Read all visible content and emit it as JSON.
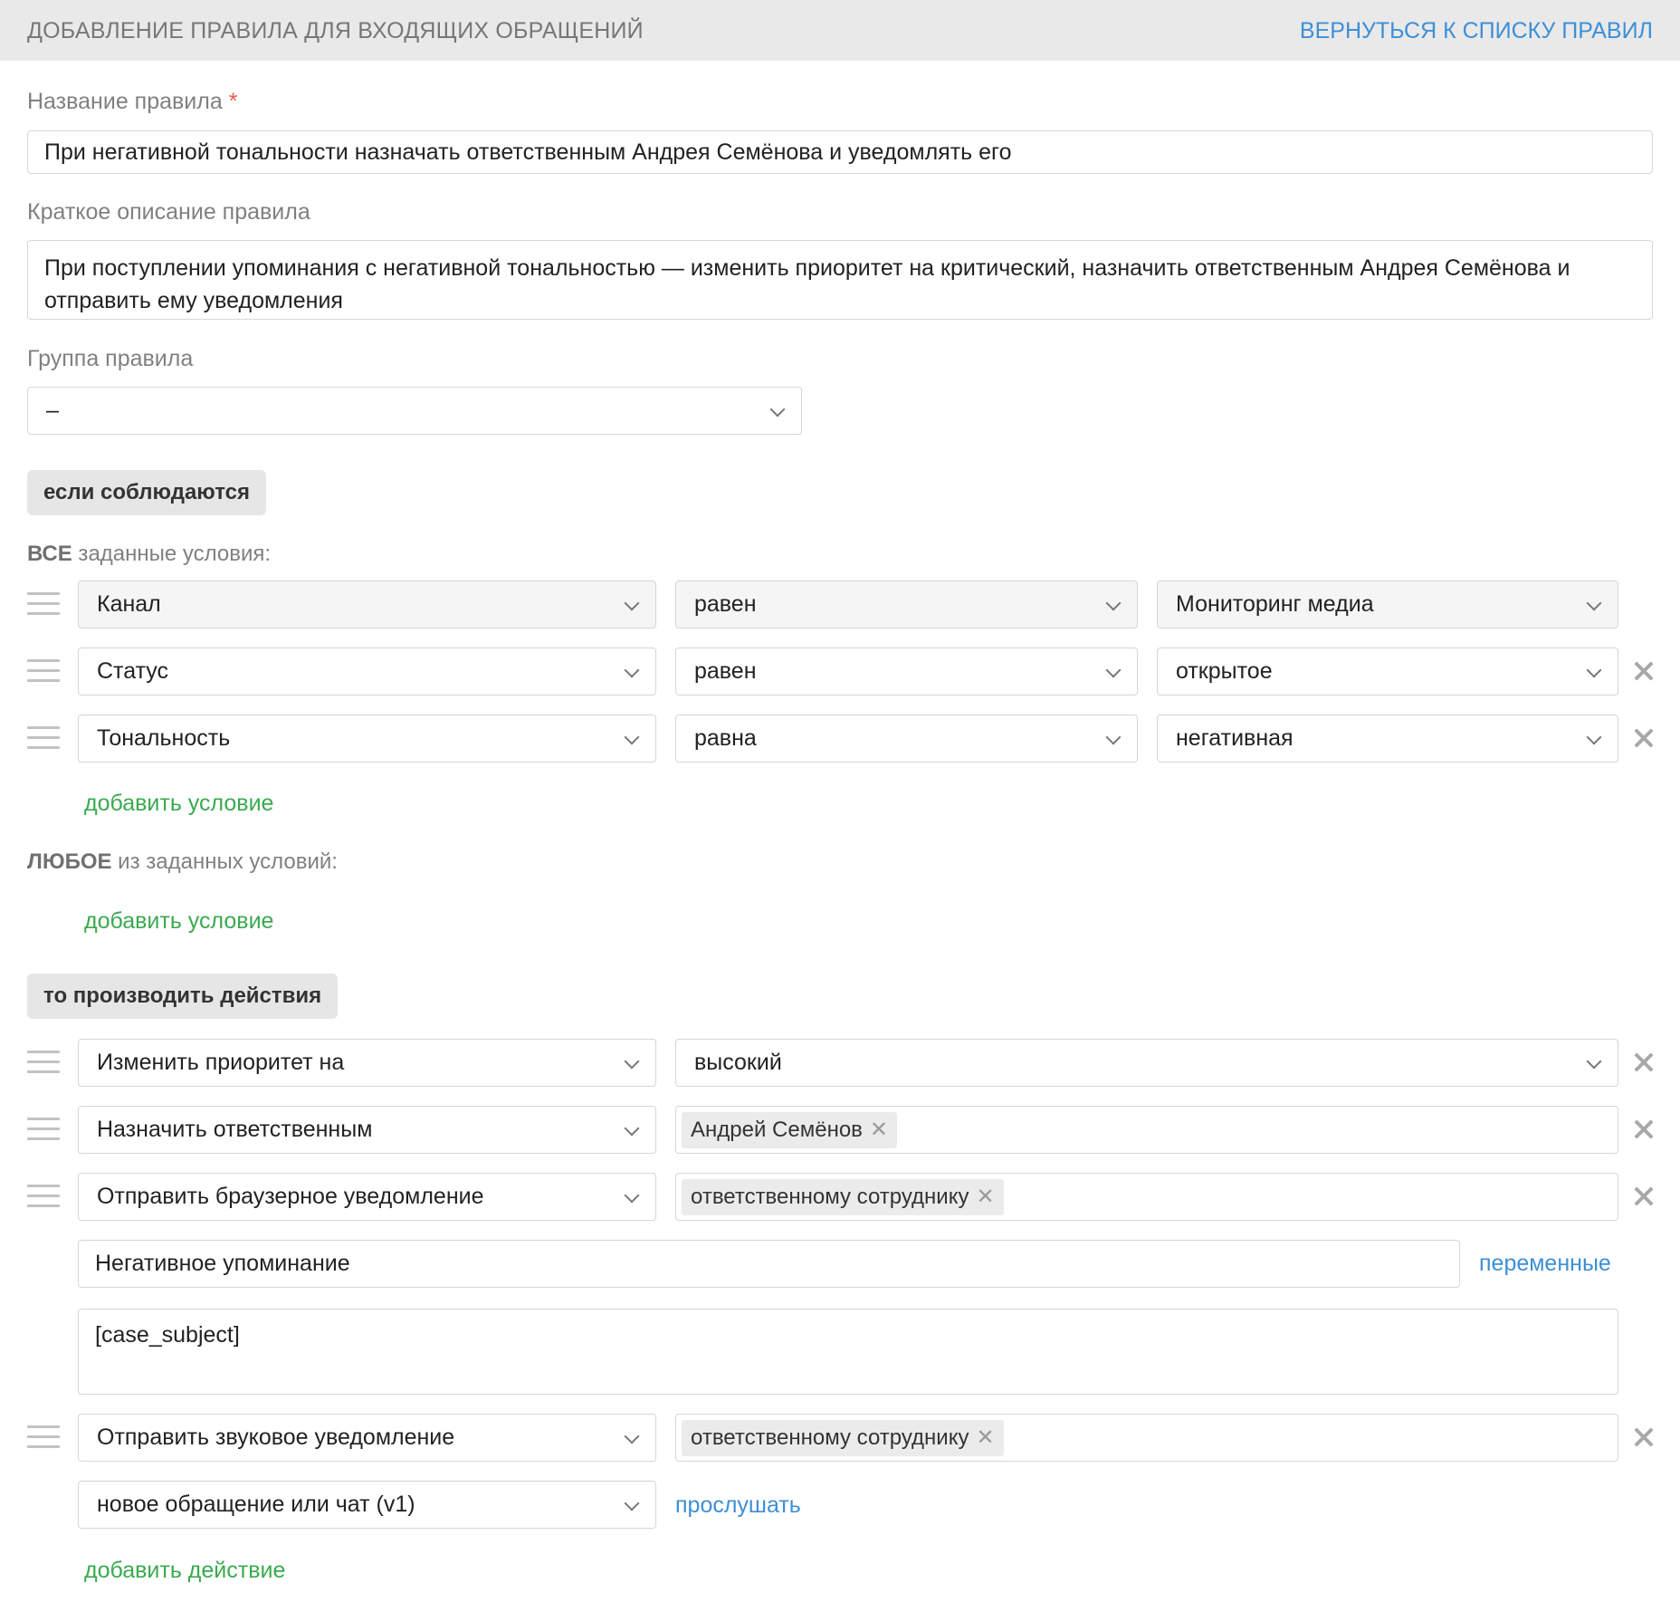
{
  "header": {
    "title": "ДОБАВЛЕНИЕ ПРАВИЛА ДЛЯ ВХОДЯЩИХ ОБРАЩЕНИЙ",
    "back_link": "ВЕРНУТЬСЯ К СПИСКУ ПРАВИЛ"
  },
  "form": {
    "name_label": "Название правила",
    "required_mark": "*",
    "name_value": "При негативной тональности назначать ответственным Андрея Семёнова и уведомлять его",
    "desc_label": "Краткое описание правила",
    "desc_value": "При поступлении упоминания с негативной тональностью — изменить приоритет на критический, назначить ответственным Андрея Семёнова и отправить ему уведомления",
    "group_label": "Группа правила",
    "group_value": "–"
  },
  "conditions": {
    "section_label": "если соблюдаются",
    "all_bold": "ВСЕ",
    "all_rest": " заданные условия:",
    "rows": [
      {
        "field": "Канал",
        "operator": "равен",
        "value": "Мониторинг медиа"
      },
      {
        "field": "Статус",
        "operator": "равен",
        "value": "открытое"
      },
      {
        "field": "Тональность",
        "operator": "равна",
        "value": "негативная"
      }
    ],
    "add_label_all": "добавить условие",
    "any_bold": "ЛЮБОЕ",
    "any_rest": " из заданных условий:",
    "add_label_any": "добавить условие"
  },
  "actions": {
    "section_label": "то производить действия",
    "rows": [
      {
        "action": "Изменить приоритет на",
        "value": "высокий"
      },
      {
        "action": "Назначить ответственным",
        "tag": "Андрей Семёнов"
      },
      {
        "action": "Отправить браузерное уведомление",
        "tag": "ответственному сотруднику"
      },
      {
        "action": "Отправить звуковое уведомление",
        "tag": "ответственному сотруднику"
      }
    ],
    "notification_title": "Негативное упоминание",
    "variables_link": "переменные",
    "notification_body": "[case_subject]",
    "sound_value": "новое обращение или чат (v1)",
    "listen_link": "прослушать",
    "add_action_label": "добавить действие"
  }
}
